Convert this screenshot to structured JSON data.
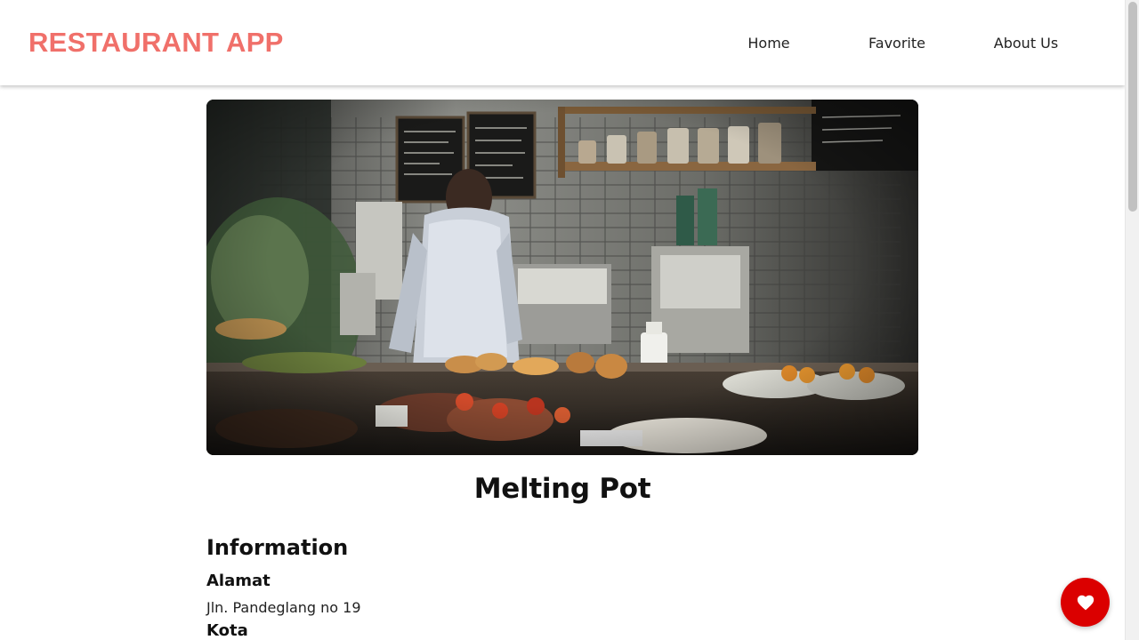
{
  "header": {
    "brand": "RESTAURANT APP",
    "nav": [
      {
        "label": "Home"
      },
      {
        "label": "Favorite"
      },
      {
        "label": "About Us"
      }
    ]
  },
  "restaurant": {
    "name": "Melting Pot",
    "image_icon": "restaurant-photo-icon",
    "information_heading": "Information",
    "address_label": "Alamat",
    "address_value": "Jln. Pandeglang no 19",
    "city_label": "Kota"
  },
  "favorite_button": {
    "icon": "heart-icon"
  },
  "colors": {
    "brand": "#f0706a",
    "favorite_button": "#db0000",
    "text": "#111111"
  }
}
